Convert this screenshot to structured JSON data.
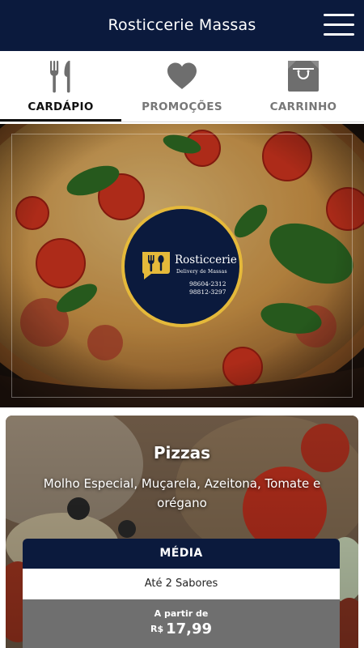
{
  "header": {
    "title": "Rosticcerie Massas"
  },
  "tabs": [
    {
      "label": "CARDÁPIO",
      "icon": "cutlery-icon",
      "active": true
    },
    {
      "label": "PROMOÇÕES",
      "icon": "heart-icon",
      "active": false
    },
    {
      "label": "CARRINHO",
      "icon": "shopping-bag-icon",
      "active": false
    }
  ],
  "hero": {
    "logo": {
      "brand": "Rosticcerie",
      "tagline": "Delivery de Massas",
      "phones": [
        "98604-2312",
        "98812-3297"
      ]
    }
  },
  "product": {
    "name": "Pizzas",
    "description": "Molho Especial, Muçarela, Azeitona, Tomate e orégano",
    "size": {
      "name": "MÉDIA",
      "flavors": "Até 2 Sabores",
      "price_prefix": "A partir de",
      "currency": "R$",
      "price": "17,99"
    }
  },
  "colors": {
    "navy": "#0b1a3d",
    "gold": "#e5b93a",
    "tab_icon_gray": "#6e6e6e",
    "price_bg": "#6f6f6f"
  }
}
